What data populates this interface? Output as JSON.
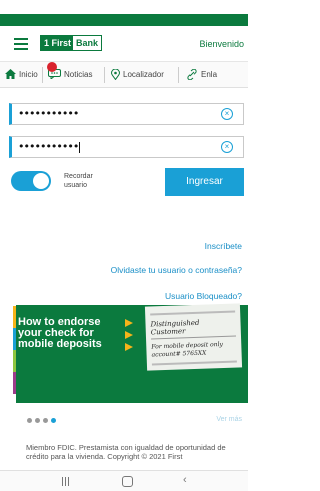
{
  "header": {
    "logo_part1": "1 First",
    "logo_part2": "Bank",
    "welcome": "Bienvenido"
  },
  "tabs": [
    {
      "label": "Inicio",
      "icon": "home-icon"
    },
    {
      "label": "Noticias",
      "icon": "chat-icon"
    },
    {
      "label": "Localizador",
      "icon": "location-icon"
    },
    {
      "label": "Enla",
      "icon": "link-icon"
    }
  ],
  "notifications_badge": "",
  "login": {
    "user_value": "•••••••••••",
    "password_value": "•••••••••••",
    "remember_label_line1": "Recordar",
    "remember_label_line2": "usuario",
    "remember_on": true,
    "submit_label": "Ingresar"
  },
  "links": {
    "register": "Inscríbete",
    "forgot": "Olvidaste tu usuario o contraseña?",
    "blocked": "Usuario Bloqueado?"
  },
  "banner": {
    "line1": "How to endorse",
    "line2": "your check for",
    "line3": "mobile deposits",
    "check_name": "Distinguished Customer",
    "check_note_line1": "For mobile deposit only",
    "check_note_line2": "account# 5765XX",
    "accent_color": "#f5b41a",
    "background_color": "#0b7a3e"
  },
  "carousel": {
    "dots": 4,
    "active_index": 3,
    "see_more": "Ver más"
  },
  "footer": {
    "text": "Miembro FDIC. Prestamista con igualdad de oportunidad de crédito para la vivienda. Copyright © 2021 First"
  },
  "colors": {
    "brand_green": "#0b7a3e",
    "accent_blue": "#1aa0d6",
    "link_blue": "#1a8fc7"
  }
}
